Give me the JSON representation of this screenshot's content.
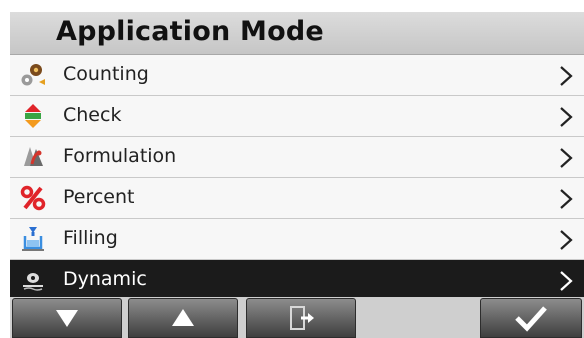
{
  "header": {
    "title": "Application Mode"
  },
  "menu": {
    "items": [
      {
        "label": "Counting",
        "icon": "counting-icon",
        "selected": false
      },
      {
        "label": "Check",
        "icon": "check-icon",
        "selected": false
      },
      {
        "label": "Formulation",
        "icon": "formulation-icon",
        "selected": false
      },
      {
        "label": "Percent",
        "icon": "percent-icon",
        "selected": false
      },
      {
        "label": "Filling",
        "icon": "filling-icon",
        "selected": false
      },
      {
        "label": "Dynamic",
        "icon": "dynamic-icon",
        "selected": true
      }
    ],
    "chevron_icon": "chevron-right-icon"
  },
  "toolbar": {
    "buttons": [
      {
        "icon": "arrow-down-icon"
      },
      {
        "icon": "arrow-up-icon"
      },
      {
        "icon": "exit-icon"
      },
      {
        "icon": "checkmark-icon"
      }
    ]
  },
  "colors": {
    "selected_row": "#1b1b1b",
    "row_background": "#f7f7f7",
    "header_background": "#cfcfcf",
    "button_dark": "#3f3f3f",
    "percent_red": "#e0242a",
    "check_orange": "#f39a1e"
  }
}
